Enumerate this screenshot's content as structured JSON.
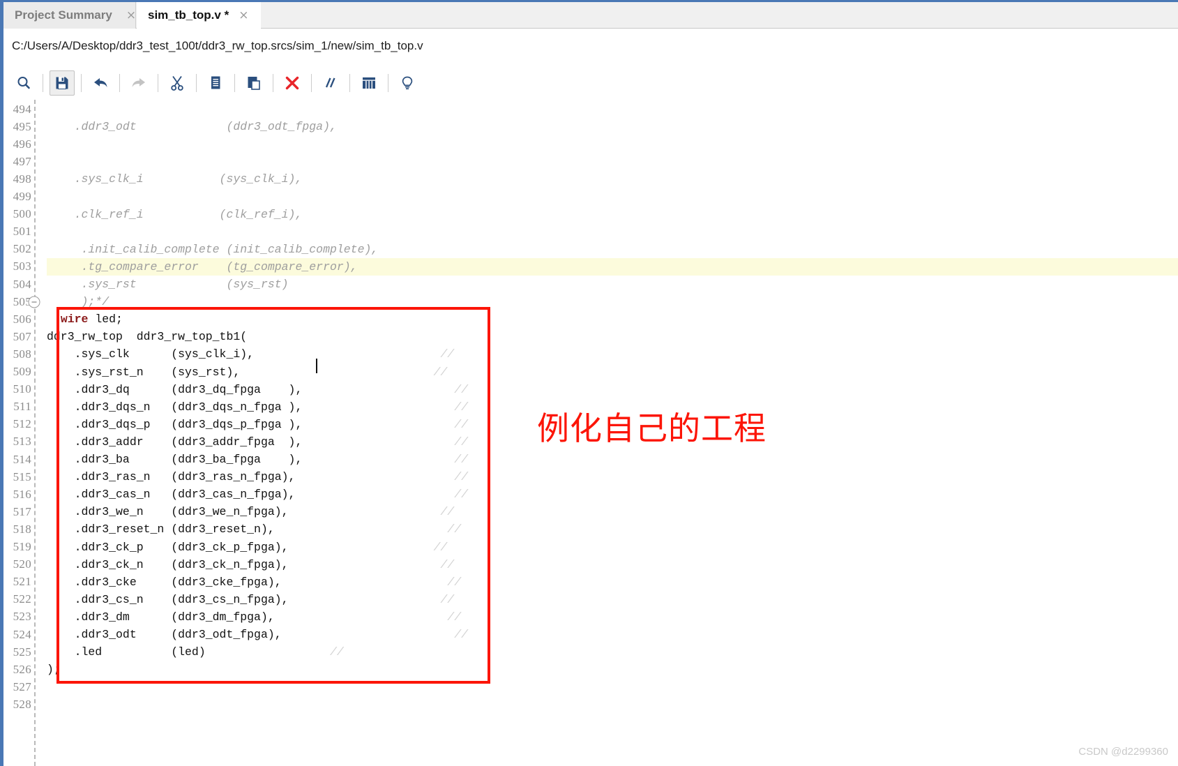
{
  "window": {
    "accent_color": "#4a78b5",
    "tabs": [
      {
        "label": "Project Summary",
        "close": "×",
        "active": false
      },
      {
        "label": "sim_tb_top.v *",
        "close": "×",
        "active": true
      }
    ]
  },
  "pathbar": {
    "path": "C:/Users/A/Desktop/ddr3_test_100t/ddr3_rw_top.srcs/sim_1/new/sim_tb_top.v"
  },
  "toolbar": {
    "buttons": [
      {
        "name": "find-icon",
        "title": "Find"
      },
      {
        "name": "save-icon",
        "title": "Save File"
      },
      {
        "name": "undo-icon",
        "title": "Undo"
      },
      {
        "name": "redo-icon",
        "title": "Redo"
      },
      {
        "name": "cut-icon",
        "title": "Cut"
      },
      {
        "name": "copy-icon",
        "title": "Copy"
      },
      {
        "name": "paste-icon",
        "title": "Paste"
      },
      {
        "name": "delete-icon",
        "title": "Delete"
      },
      {
        "name": "comment-icon",
        "title": "Toggle Comment"
      },
      {
        "name": "columns-icon",
        "title": "Show Columns"
      },
      {
        "name": "lightbulb-icon",
        "title": "Suggestions"
      }
    ]
  },
  "editor": {
    "first_line": 494,
    "highlight_line": 503,
    "fold_line": 505,
    "lines": [
      {
        "n": 494,
        "segments": []
      },
      {
        "n": 495,
        "segments": [
          {
            "t": "    .ddr3_odt             (ddr3_odt_fpga),",
            "s": "cmt"
          }
        ]
      },
      {
        "n": 496,
        "segments": []
      },
      {
        "n": 497,
        "segments": []
      },
      {
        "n": 498,
        "segments": [
          {
            "t": "    .sys_clk_i           (sys_clk_i),",
            "s": "cmt"
          }
        ]
      },
      {
        "n": 499,
        "segments": []
      },
      {
        "n": 500,
        "segments": [
          {
            "t": "    .clk_ref_i           (clk_ref_i),",
            "s": "cmt"
          }
        ]
      },
      {
        "n": 501,
        "segments": []
      },
      {
        "n": 502,
        "segments": [
          {
            "t": "     .init_calib_complete (init_calib_complete),",
            "s": "cmt"
          }
        ]
      },
      {
        "n": 503,
        "segments": [
          {
            "t": "     .tg_compare_error    (tg_compare_error),",
            "s": "cmt"
          }
        ]
      },
      {
        "n": 504,
        "segments": [
          {
            "t": "     .sys_rst             (sys_rst)",
            "s": "cmt"
          }
        ]
      },
      {
        "n": 505,
        "segments": [
          {
            "t": "     );*/",
            "s": "cmt"
          }
        ]
      },
      {
        "n": 506,
        "segments": [
          {
            "t": "  ",
            "s": ""
          },
          {
            "t": "wire",
            "s": "kw"
          },
          {
            "t": " led;",
            "s": ""
          }
        ]
      },
      {
        "n": 507,
        "segments": [
          {
            "t": "ddr3_rw_top  ddr3_rw_top_tb1(",
            "s": ""
          }
        ]
      },
      {
        "n": 508,
        "segments": [
          {
            "t": "    .sys_clk      (sys_clk_i),                           ",
            "s": ""
          },
          {
            "t": "//",
            "s": "cmt-faint"
          }
        ]
      },
      {
        "n": 509,
        "segments": [
          {
            "t": "    .sys_rst_n    (sys_rst),                            ",
            "s": ""
          },
          {
            "t": "//",
            "s": "cmt-faint"
          }
        ]
      },
      {
        "n": 510,
        "segments": [
          {
            "t": "    .ddr3_dq      (ddr3_dq_fpga    ),                      ",
            "s": ""
          },
          {
            "t": "//",
            "s": "cmt-faint"
          }
        ]
      },
      {
        "n": 511,
        "segments": [
          {
            "t": "    .ddr3_dqs_n   (ddr3_dqs_n_fpga ),                      ",
            "s": ""
          },
          {
            "t": "//",
            "s": "cmt-faint"
          }
        ]
      },
      {
        "n": 512,
        "segments": [
          {
            "t": "    .ddr3_dqs_p   (ddr3_dqs_p_fpga ),                      ",
            "s": ""
          },
          {
            "t": "//",
            "s": "cmt-faint"
          }
        ]
      },
      {
        "n": 513,
        "segments": [
          {
            "t": "    .ddr3_addr    (ddr3_addr_fpga  ),                      ",
            "s": ""
          },
          {
            "t": "//",
            "s": "cmt-faint"
          }
        ]
      },
      {
        "n": 514,
        "segments": [
          {
            "t": "    .ddr3_ba      (ddr3_ba_fpga    ),                      ",
            "s": ""
          },
          {
            "t": "//",
            "s": "cmt-faint"
          }
        ]
      },
      {
        "n": 515,
        "segments": [
          {
            "t": "    .ddr3_ras_n   (ddr3_ras_n_fpga),                       ",
            "s": ""
          },
          {
            "t": "//",
            "s": "cmt-faint"
          }
        ]
      },
      {
        "n": 516,
        "segments": [
          {
            "t": "    .ddr3_cas_n   (ddr3_cas_n_fpga),                       ",
            "s": ""
          },
          {
            "t": "//",
            "s": "cmt-faint"
          }
        ]
      },
      {
        "n": 517,
        "segments": [
          {
            "t": "    .ddr3_we_n    (ddr3_we_n_fpga),                      ",
            "s": ""
          },
          {
            "t": "//",
            "s": "cmt-faint"
          }
        ]
      },
      {
        "n": 518,
        "segments": [
          {
            "t": "    .ddr3_reset_n (ddr3_reset_n),                         ",
            "s": ""
          },
          {
            "t": "//",
            "s": "cmt-faint"
          }
        ]
      },
      {
        "n": 519,
        "segments": [
          {
            "t": "    .ddr3_ck_p    (ddr3_ck_p_fpga),                     ",
            "s": ""
          },
          {
            "t": "//",
            "s": "cmt-faint"
          }
        ]
      },
      {
        "n": 520,
        "segments": [
          {
            "t": "    .ddr3_ck_n    (ddr3_ck_n_fpga),                      ",
            "s": ""
          },
          {
            "t": "//",
            "s": "cmt-faint"
          }
        ]
      },
      {
        "n": 521,
        "segments": [
          {
            "t": "    .ddr3_cke     (ddr3_cke_fpga),                        ",
            "s": ""
          },
          {
            "t": "//",
            "s": "cmt-faint"
          }
        ]
      },
      {
        "n": 522,
        "segments": [
          {
            "t": "    .ddr3_cs_n    (ddr3_cs_n_fpga),                      ",
            "s": ""
          },
          {
            "t": "//",
            "s": "cmt-faint"
          }
        ]
      },
      {
        "n": 523,
        "segments": [
          {
            "t": "    .ddr3_dm      (ddr3_dm_fpga),                         ",
            "s": ""
          },
          {
            "t": "//",
            "s": "cmt-faint"
          }
        ]
      },
      {
        "n": 524,
        "segments": [
          {
            "t": "    .ddr3_odt     (ddr3_odt_fpga),                         ",
            "s": ""
          },
          {
            "t": "//",
            "s": "cmt-faint"
          }
        ]
      },
      {
        "n": 525,
        "segments": [
          {
            "t": "    .led          (led)                  ",
            "s": ""
          },
          {
            "t": "//",
            "s": "cmt-faint"
          }
        ]
      },
      {
        "n": 526,
        "segments": [
          {
            "t": ");",
            "s": ""
          }
        ]
      },
      {
        "n": 527,
        "segments": []
      },
      {
        "n": 528,
        "segments": []
      }
    ]
  },
  "annotation": {
    "note_text": "例化自己的工程",
    "note_color": "#fc1507",
    "box_color": "#fc1507"
  },
  "watermark": {
    "text": "CSDN @d2299360"
  }
}
